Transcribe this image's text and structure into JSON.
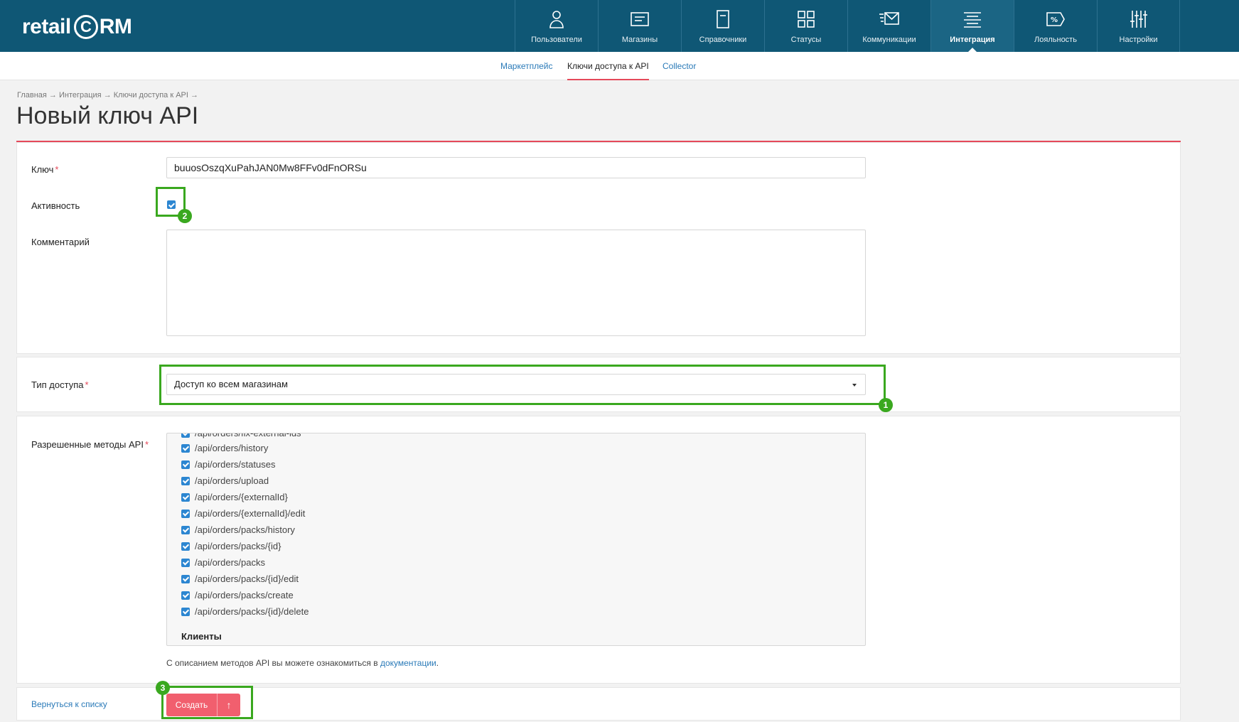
{
  "header": {
    "logo_text": "retail",
    "logo_crm_c": "C",
    "logo_crm_rest": "RM",
    "nav": [
      {
        "label": "Пользователи",
        "icon": "user-icon"
      },
      {
        "label": "Магазины",
        "icon": "store-icon"
      },
      {
        "label": "Справочники",
        "icon": "book-icon"
      },
      {
        "label": "Статусы",
        "icon": "status-grid-icon"
      },
      {
        "label": "Коммуникации",
        "icon": "mail-icon"
      },
      {
        "label": "Интеграция",
        "icon": "integration-icon",
        "active": true
      },
      {
        "label": "Лояльность",
        "icon": "percent-tag-icon"
      },
      {
        "label": "Настройки",
        "icon": "sliders-icon"
      }
    ]
  },
  "subnav": {
    "items": [
      "Маркетплейс",
      "Ключи доступа к API",
      "Collector"
    ],
    "active": 1
  },
  "breadcrumb": "Главная → Интеграция → Ключи доступа к API →",
  "page_title": "Новый ключ API",
  "form": {
    "key_label": "Ключ",
    "key_value": "buuosOszqXuPahJAN0Mw8FFv0dFnORSu",
    "active_label": "Активность",
    "active_checked": true,
    "comment_label": "Комментарий",
    "comment_value": "",
    "access_type_label": "Тип доступа",
    "access_type_value": "Доступ ко всем магазинам",
    "methods_label": "Разрешенные методы API",
    "methods_partial": "/api/orders/fix-external-ids",
    "methods": [
      "/api/orders/history",
      "/api/orders/statuses",
      "/api/orders/upload",
      "/api/orders/{externalId}",
      "/api/orders/{externalId}/edit",
      "/api/orders/packs/history",
      "/api/orders/packs/{id}",
      "/api/orders/packs",
      "/api/orders/packs/{id}/edit",
      "/api/orders/packs/create",
      "/api/orders/packs/{id}/delete"
    ],
    "methods_group": "Клиенты",
    "hint_text": "С описанием методов API вы можете ознакомиться в ",
    "hint_link": "документации",
    "hint_end": "."
  },
  "footer": {
    "back_label": "Вернуться к списку",
    "create_label": "Создать",
    "create_icon": "↑"
  },
  "annotations": [
    "1",
    "2",
    "3"
  ],
  "colors": {
    "header_bg": "#0f5775",
    "accent_red": "#e5495a",
    "button_red": "#f15f6e",
    "checkbox_blue": "#2c86d1",
    "highlight_green": "#3aa81f",
    "link_blue": "#2a7ab8"
  }
}
